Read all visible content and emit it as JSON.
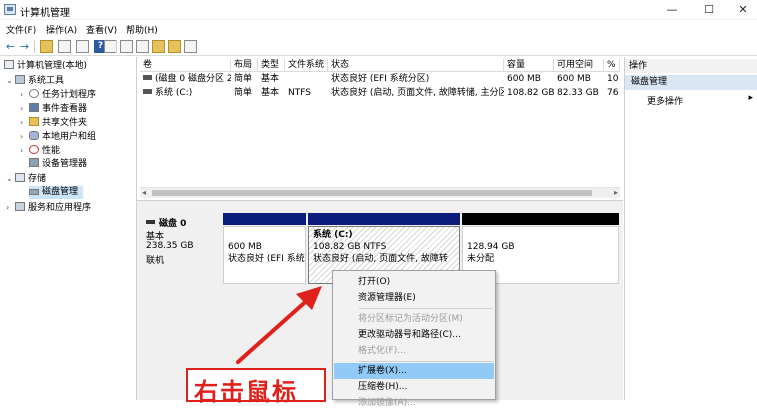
{
  "window": {
    "title": "计算机管理",
    "minimize": "—",
    "maximize": "☐",
    "close": "✕"
  },
  "menu": [
    "文件(F)",
    "操作(A)",
    "查看(V)",
    "帮助(H)"
  ],
  "toolbar": {
    "back": "←",
    "forward": "→",
    "help": "?"
  },
  "tree": [
    {
      "label": "计算机管理(本地)",
      "expander": ""
    },
    {
      "label": "系统工具",
      "expander": "⌄"
    },
    {
      "label": "任务计划程序",
      "expander": "›"
    },
    {
      "label": "事件查看器",
      "expander": "›"
    },
    {
      "label": "共享文件夹",
      "expander": "›"
    },
    {
      "label": "本地用户和组",
      "expander": "›"
    },
    {
      "label": "性能",
      "expander": "›"
    },
    {
      "label": "设备管理器",
      "expander": ""
    },
    {
      "label": "存储",
      "expander": "⌄"
    },
    {
      "label": "磁盘管理",
      "expander": ""
    },
    {
      "label": "服务和应用程序",
      "expander": "›"
    }
  ],
  "volume_table": {
    "columns": [
      "卷",
      "布局",
      "类型",
      "文件系统",
      "状态",
      "容量",
      "可用空间",
      "%"
    ],
    "rows": [
      [
        "(磁盘 0 磁盘分区 2)",
        "简单",
        "基本",
        "",
        "状态良好 (EFI 系统分区)",
        "600 MB",
        "600 MB",
        "10"
      ],
      [
        "系统 (C:)",
        "简单",
        "基本",
        "NTFS",
        "状态良好 (启动, 页面文件, 故障转储, 主分区)",
        "108.82 GB",
        "82.33 GB",
        "76"
      ]
    ]
  },
  "disk": {
    "name": "磁盘 0",
    "type": "基本",
    "size": "238.35 GB",
    "status": "联机",
    "partitions": [
      {
        "title": "",
        "size": "600 MB",
        "status": "状态良好 (EFI 系统分"
      },
      {
        "title": "系统  (C:)",
        "size": "108.82 GB NTFS",
        "status": "状态良好 (启动, 页面文件, 故障转"
      },
      {
        "title": "",
        "size": "128.94 GB",
        "status": "未分配"
      }
    ]
  },
  "context_menu": [
    {
      "label": "打开(O)",
      "disabled": false
    },
    {
      "label": "资源管理器(E)",
      "disabled": false
    },
    {
      "label": "将分区标记为活动分区(M)",
      "disabled": true
    },
    {
      "label": "更改驱动器号和路径(C)...",
      "disabled": false
    },
    {
      "label": "格式化(F)...",
      "disabled": true
    },
    {
      "label": "扩展卷(X)...",
      "disabled": false
    },
    {
      "label": "压缩卷(H)...",
      "disabled": false
    },
    {
      "label": "添加镜像(A)...",
      "disabled": true
    }
  ],
  "actions": {
    "header": "操作",
    "group": "磁盘管理",
    "more": "更多操作",
    "more_arrow": "▸"
  },
  "annotation": {
    "text": "右击鼠标",
    "color": "#e0201b"
  },
  "colors": {
    "partition_header": "#0b1c7c",
    "unallocated_header": "#000000",
    "selection": "#cce4f7",
    "menu_highlight": "#91c9f7"
  }
}
